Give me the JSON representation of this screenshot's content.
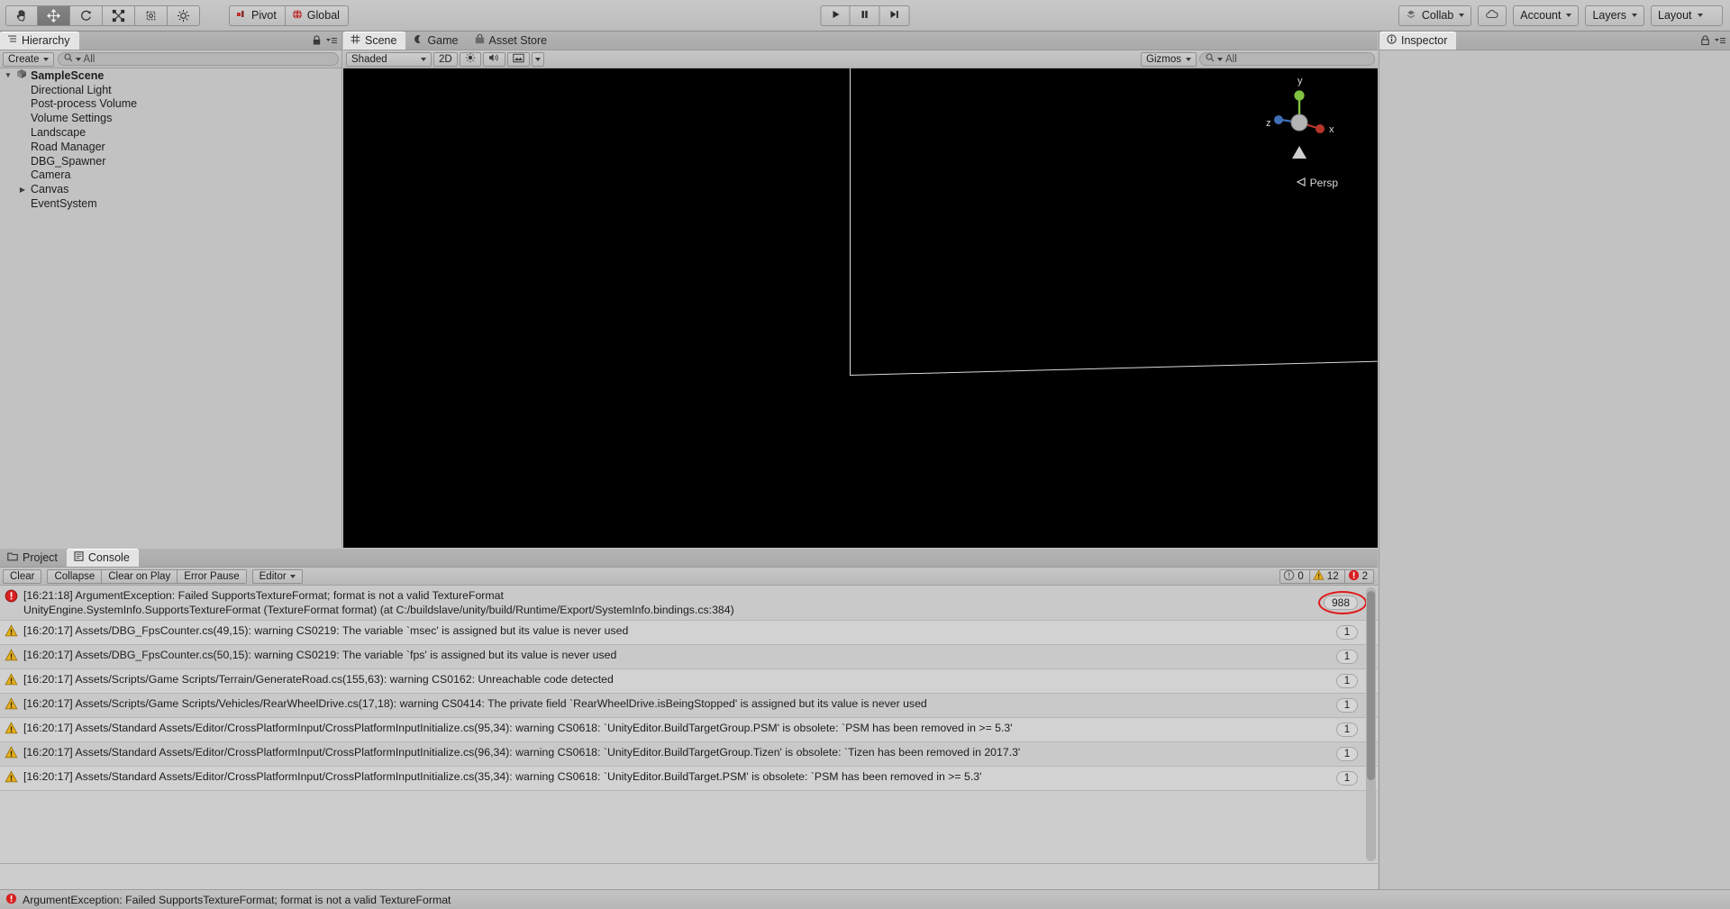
{
  "toolbar": {
    "tools": [
      {
        "name": "hand-tool",
        "icon": "hand-icon",
        "selected": false
      },
      {
        "name": "move-tool",
        "icon": "move-icon",
        "selected": true
      },
      {
        "name": "rotate-tool",
        "icon": "rotate-icon",
        "selected": false
      },
      {
        "name": "scale-tool",
        "icon": "scale-icon",
        "selected": false
      },
      {
        "name": "rect-tool",
        "icon": "rect-transform-icon",
        "selected": false
      },
      {
        "name": "transform-tool",
        "icon": "combined-transform-icon",
        "selected": false
      }
    ],
    "pivot_label": "Pivot",
    "global_label": "Global",
    "play_label": "play-icon",
    "pause_label": "pause-icon",
    "step_label": "step-icon",
    "collab_label": "Collab",
    "cloud_label": "cloud-icon",
    "account_label": "Account",
    "layers_label": "Layers",
    "layout_label": "Layout"
  },
  "hierarchy": {
    "tab_label": "Hierarchy",
    "create_label": "Create",
    "search_placeholder": "All",
    "items": [
      {
        "label": "SampleScene",
        "depth": 0,
        "arrow": "down",
        "root": true
      },
      {
        "label": "Directional Light",
        "depth": 1,
        "arrow": "",
        "root": false
      },
      {
        "label": "Post-process Volume",
        "depth": 1,
        "arrow": "",
        "root": false
      },
      {
        "label": "Volume Settings",
        "depth": 1,
        "arrow": "",
        "root": false
      },
      {
        "label": "Landscape",
        "depth": 1,
        "arrow": "",
        "root": false
      },
      {
        "label": "Road Manager",
        "depth": 1,
        "arrow": "",
        "root": false
      },
      {
        "label": "DBG_Spawner",
        "depth": 1,
        "arrow": "",
        "root": false
      },
      {
        "label": "Camera",
        "depth": 1,
        "arrow": "",
        "root": false
      },
      {
        "label": "Canvas",
        "depth": 1,
        "arrow": "right",
        "root": false
      },
      {
        "label": "EventSystem",
        "depth": 1,
        "arrow": "",
        "root": false
      }
    ]
  },
  "scene": {
    "tabs": [
      {
        "label": "Scene",
        "icon": "grid-icon",
        "active": true
      },
      {
        "label": "Game",
        "icon": "gamepad-icon",
        "active": false
      },
      {
        "label": "Asset Store",
        "icon": "store-icon",
        "active": false
      }
    ],
    "draw_mode": "Shaded",
    "two_d_label": "2D",
    "lighting_icon": "sun-icon",
    "audio_icon": "speaker-icon",
    "fx_icon": "image-icon",
    "gizmos_label": "Gizmos",
    "gizmo_search_placeholder": "All",
    "axis_labels": {
      "y": "y",
      "x": "x",
      "z": "z"
    },
    "perspective_label": "Persp"
  },
  "inspector": {
    "tab_label": "Inspector"
  },
  "console": {
    "tabs": [
      {
        "label": "Project",
        "icon": "folder-icon",
        "active": false
      },
      {
        "label": "Console",
        "icon": "console-icon",
        "active": true
      }
    ],
    "buttons": {
      "clear": "Clear",
      "collapse": "Collapse",
      "clear_on_play": "Clear on Play",
      "error_pause": "Error Pause",
      "editor": "Editor"
    },
    "badges": {
      "info": "0",
      "warning": "12",
      "error": "2"
    },
    "messages": [
      {
        "type": "error",
        "lines": [
          "[16:21:18] ArgumentException: Failed SupportsTextureFormat; format is not a valid TextureFormat",
          "UnityEngine.SystemInfo.SupportsTextureFormat (TextureFormat format) (at C:/buildslave/unity/build/Runtime/Export/SystemInfo.bindings.cs:384)"
        ],
        "count": "988",
        "highlighted": true
      },
      {
        "type": "warning",
        "lines": [
          "[16:20:17] Assets/DBG_FpsCounter.cs(49,15): warning CS0219: The variable `msec' is assigned but its value is never used"
        ],
        "count": "1",
        "highlighted": false
      },
      {
        "type": "warning",
        "lines": [
          "[16:20:17] Assets/DBG_FpsCounter.cs(50,15): warning CS0219: The variable `fps' is assigned but its value is never used"
        ],
        "count": "1",
        "highlighted": false
      },
      {
        "type": "warning",
        "lines": [
          "[16:20:17] Assets/Scripts/Game Scripts/Terrain/GenerateRoad.cs(155,63): warning CS0162: Unreachable code detected"
        ],
        "count": "1",
        "highlighted": false
      },
      {
        "type": "warning",
        "lines": [
          "[16:20:17] Assets/Scripts/Game Scripts/Vehicles/RearWheelDrive.cs(17,18): warning CS0414: The private field `RearWheelDrive.isBeingStopped' is assigned but its value is never used"
        ],
        "count": "1",
        "highlighted": false
      },
      {
        "type": "warning",
        "lines": [
          "[16:20:17] Assets/Standard Assets/Editor/CrossPlatformInput/CrossPlatformInputInitialize.cs(95,34): warning CS0618: `UnityEditor.BuildTargetGroup.PSM' is obsolete: `PSM has been removed in >= 5.3'"
        ],
        "count": "1",
        "highlighted": false
      },
      {
        "type": "warning",
        "lines": [
          "[16:20:17] Assets/Standard Assets/Editor/CrossPlatformInput/CrossPlatformInputInitialize.cs(96,34): warning CS0618: `UnityEditor.BuildTargetGroup.Tizen' is obsolete: `Tizen has been removed in 2017.3'"
        ],
        "count": "1",
        "highlighted": false
      },
      {
        "type": "warning",
        "lines": [
          "[16:20:17] Assets/Standard Assets/Editor/CrossPlatformInput/CrossPlatformInputInitialize.cs(35,34): warning CS0618: `UnityEditor.BuildTarget.PSM' is obsolete: `PSM has been removed in >= 5.3'"
        ],
        "count": "1",
        "highlighted": false
      }
    ]
  },
  "statusbar": {
    "message": "ArgumentException: Failed SupportsTextureFormat; format is not a valid TextureFormat",
    "icon": "error-icon"
  },
  "colors": {
    "error_red": "#d82020",
    "warning_yellow": "#e8b020",
    "panel_bg": "#c2c2c2",
    "scene_bg": "#000000",
    "highlight_ring": "#e01a1a"
  }
}
